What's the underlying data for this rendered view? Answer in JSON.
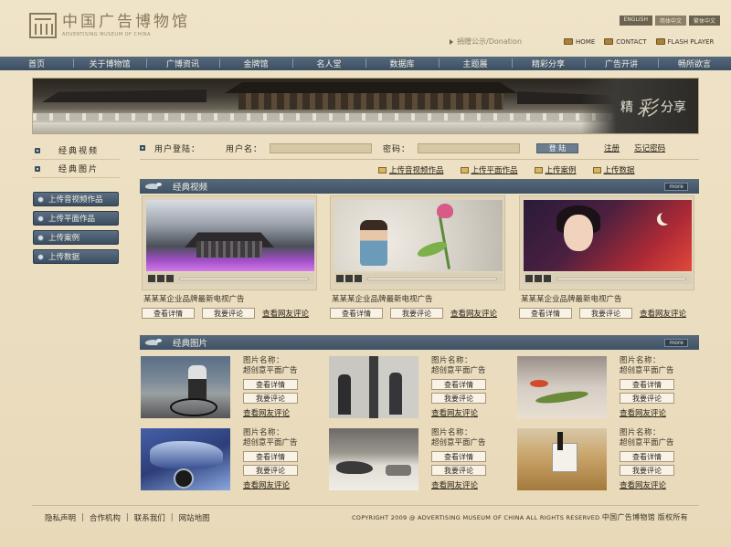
{
  "header": {
    "logo_cn": "中国广告博物馆",
    "logo_en": "ADVERTISING MUSEUM OF CHINA",
    "lang": [
      "ENGLISH",
      "简体中文",
      "繁体中文"
    ],
    "donation": "捐赠公示/Donation",
    "toplinks": [
      "HOME",
      "CONTACT",
      "FLASH PLAYER"
    ]
  },
  "nav": [
    "首页",
    "关于博物馆",
    "广博资讯",
    "金牌馆",
    "名人堂",
    "数据库",
    "主题展",
    "精彩分享",
    "广告开讲",
    "畅所欲言"
  ],
  "banner": {
    "title_big": "精",
    "title_mid": "彩",
    "title_end": "分享"
  },
  "sidebar": {
    "categories": [
      "经典视频",
      "经典图片"
    ],
    "buttons": [
      "上传音视频作品",
      "上传平面作品",
      "上传案例",
      "上传数据"
    ]
  },
  "login": {
    "title": "用户登陆：",
    "username_label": "用户名：",
    "password_label": "密码：",
    "submit": "登 陆",
    "register": "注册",
    "forgot": "忘记密码"
  },
  "uploads": [
    "上传音视频作品",
    "上传平面作品",
    "上传案例",
    "上传数据"
  ],
  "videos": {
    "title": "经典视频",
    "more": "more",
    "items": [
      {
        "caption": "某某某企业品牌最新电视广告"
      },
      {
        "caption": "某某某企业品牌最新电视广告"
      },
      {
        "caption": "某某某企业品牌最新电视广告"
      }
    ],
    "btn_detail": "查看详情",
    "btn_comment": "我要评论",
    "link_comments": "查看网友评论"
  },
  "photos": {
    "title": "经典图片",
    "more": "more",
    "name_label": "图片名称：",
    "name_value": "超创意平面广告",
    "btn_detail": "查看详情",
    "btn_comment": "我要评论",
    "link_comments": "查看网友评论"
  },
  "footer": {
    "links": [
      "隐私声明",
      "合作机构",
      "联系我们",
      "网站地图"
    ],
    "copyright": "COPYRIGHT 2009 @ ADVERTISING MUSEUM OF CHINA  ALL RIGHTS RESERVED",
    "copyright_cn": "中国广告博物馆  版权所有"
  }
}
